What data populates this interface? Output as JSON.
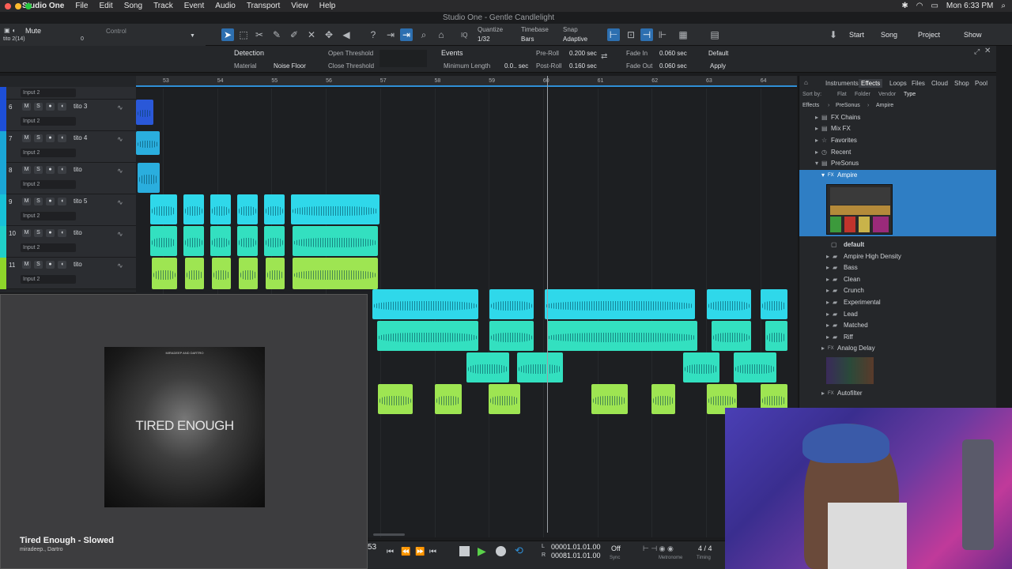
{
  "menubar": {
    "app": "Studio One",
    "items": [
      "File",
      "Edit",
      "Song",
      "Track",
      "Event",
      "Audio",
      "Transport",
      "View",
      "Help"
    ],
    "window_title": "Studio One - Gentle Candlelight",
    "clock": "Mon 6:33 PM"
  },
  "inspector": {
    "mute_label": "Mute",
    "track_label": "tito 2(14)",
    "control_label": "Control",
    "value": "0"
  },
  "toolbar": {
    "quantize_label": "Quantize",
    "quantize_value": "1/32",
    "timebase_label": "Timebase",
    "timebase_value": "Bars",
    "snap_label": "Snap",
    "snap_value": "Adaptive",
    "start_label": "Start",
    "song_label": "Song",
    "project_label": "Project",
    "show_label": "Show",
    "iq_label": "IQ"
  },
  "detection": {
    "title": "Detection",
    "material_label": "Material",
    "material_value": "Noise Floor",
    "open_threshold": "Open Threshold",
    "close_threshold": "Close Threshold",
    "events_title": "Events",
    "minimum_length": "Minimum Length",
    "minimum_length_value": "0.0.. sec",
    "pre_roll": "Pre-Roll",
    "pre_roll_value": "0.200 sec",
    "post_roll": "Post-Roll",
    "post_roll_value": "0.160 sec",
    "fade_in": "Fade In",
    "fade_in_value": "0.060 sec",
    "fade_out": "Fade Out",
    "fade_out_value": "0.060 sec",
    "preset": "Default",
    "apply": "Apply"
  },
  "tracks": [
    {
      "num": "6",
      "name": "tito 3",
      "input": "Input 2",
      "color": "#1d4fd8"
    },
    {
      "num": "7",
      "name": "tito 4",
      "input": "Input 2",
      "color": "#1aa6d6"
    },
    {
      "num": "8",
      "name": "tito",
      "input": "Input 2",
      "color": "#1aa6d6"
    },
    {
      "num": "9",
      "name": "tito 5",
      "input": "Input 2",
      "color": "#17c2d8"
    },
    {
      "num": "10",
      "name": "tito",
      "input": "Input 2",
      "color": "#20d0c8"
    },
    {
      "num": "11",
      "name": "tito",
      "input": "Input 2",
      "color": "#8ed62a"
    }
  ],
  "track_buttons": {
    "m": "M",
    "s": "S"
  },
  "top_input": "Input 2",
  "ruler": [
    "53",
    "54",
    "55",
    "56",
    "57",
    "58",
    "59",
    "60",
    "61",
    "62",
    "63",
    "64"
  ],
  "browser": {
    "tabs": [
      "Instruments",
      "Effects",
      "Loops",
      "Files",
      "Cloud",
      "Shop",
      "Pool"
    ],
    "sort_label": "Sort by:",
    "sort_options": [
      "Flat",
      "Folder",
      "Vendor",
      "Type"
    ],
    "path": [
      "Effects",
      "PreSonus",
      "Ampire"
    ],
    "rows": [
      "FX Chains",
      "Mix FX",
      "Favorites",
      "Recent",
      "PreSonus",
      "Ampire"
    ],
    "presets": [
      "default",
      "Ampire High Density",
      "Bass",
      "Clean",
      "Crunch",
      "Experimental",
      "Lead",
      "Matched",
      "Riff"
    ],
    "after": [
      "Analog Delay",
      "Autofilter"
    ]
  },
  "music": {
    "cover_title": "TIRED ENOUGH",
    "cover_top": "MIRADEEP AND DARTRO",
    "song": "Tired Enough - Slowed",
    "artist": "miradeep., Dartro"
  },
  "transport": {
    "bar_fragment": "53",
    "time1": "00001.01.01.00",
    "time2": "00081.01.01.00",
    "off_label": "Off",
    "sync_label": "Sync",
    "metronome_label": "Metronome",
    "signature": "4 / 4",
    "timing_label": "Timing"
  },
  "colors": {
    "accent": "#2f8fd6",
    "clip_cyan": "#2fd8ea",
    "clip_teal": "#33e0c0",
    "clip_green": "#9ee552",
    "selected": "#2f7ec4"
  }
}
